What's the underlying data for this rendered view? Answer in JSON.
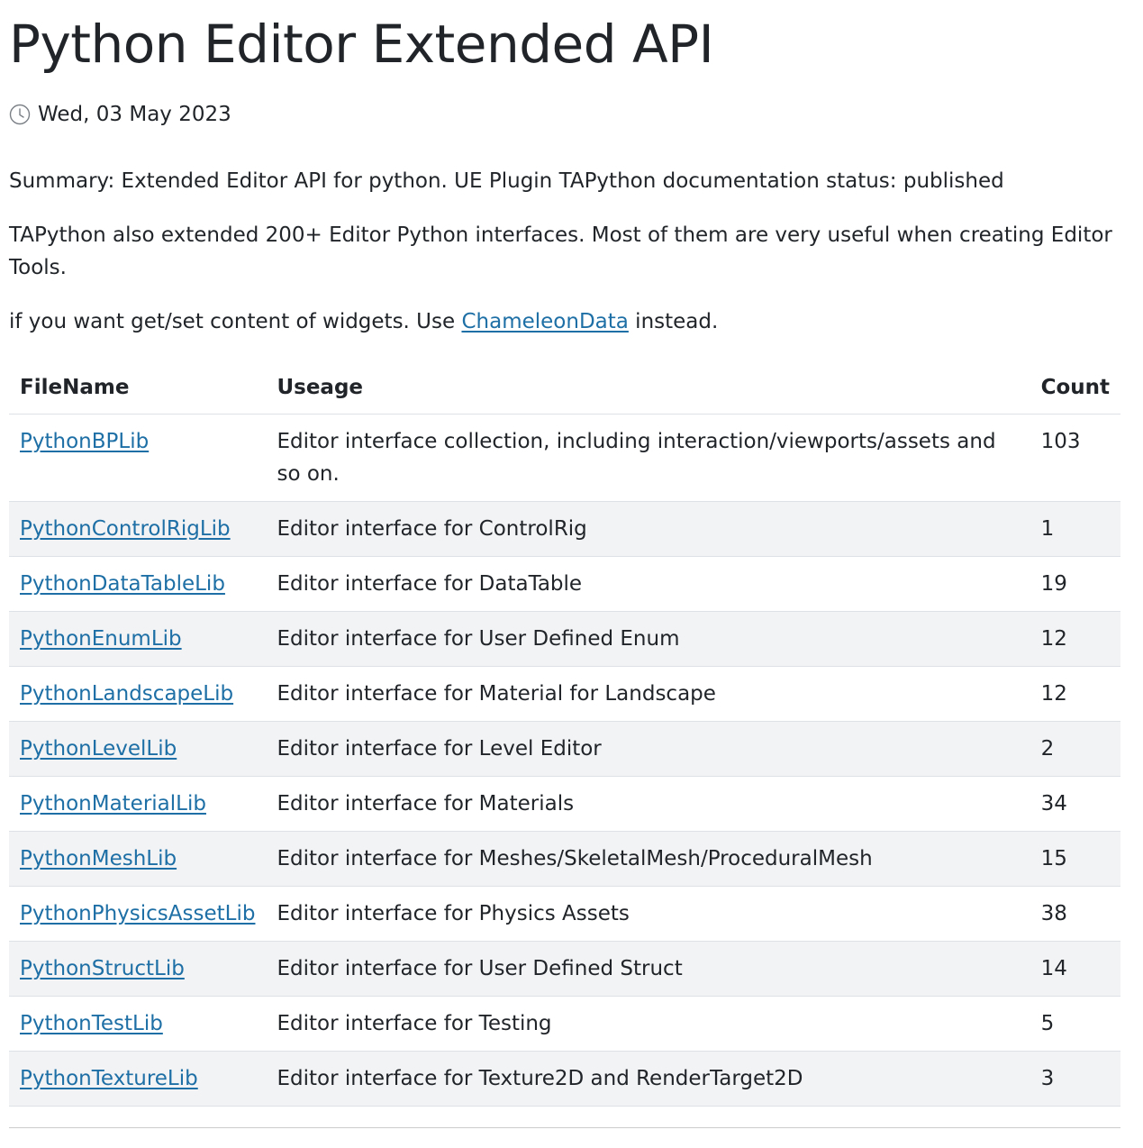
{
  "page": {
    "title": "Python Editor Extended API",
    "date": "Wed, 03 May 2023",
    "summary": "Summary: Extended Editor API for python. UE Plugin TAPython documentation status: published",
    "intro": "TAPython also extended 200+ Editor Python interfaces. Most of them are very useful when creating Editor Tools.",
    "widgets_note_before": "if you want get/set content of widgets. Use ",
    "widgets_note_link": "ChameleonData",
    "widgets_note_after": " instead."
  },
  "table": {
    "headers": {
      "filename": "FileName",
      "usage": "Useage",
      "count": "Count"
    },
    "rows": [
      {
        "filename": "PythonBPLib",
        "usage": "Editor interface collection, including interaction/viewports/assets and so on.",
        "count": "103"
      },
      {
        "filename": "PythonControlRigLib",
        "usage": "Editor interface for ControlRig",
        "count": "1"
      },
      {
        "filename": "PythonDataTableLib",
        "usage": "Editor interface for DataTable",
        "count": "19"
      },
      {
        "filename": "PythonEnumLib",
        "usage": "Editor interface for User Defined Enum",
        "count": "12"
      },
      {
        "filename": "PythonLandscapeLib",
        "usage": "Editor interface for Material for Landscape",
        "count": "12"
      },
      {
        "filename": "PythonLevelLib",
        "usage": "Editor interface for Level Editor",
        "count": "2"
      },
      {
        "filename": "PythonMaterialLib",
        "usage": "Editor interface for Materials",
        "count": "34"
      },
      {
        "filename": "PythonMeshLib",
        "usage": "Editor interface for Meshes/SkeletalMesh/ProceduralMesh",
        "count": "15"
      },
      {
        "filename": "PythonPhysicsAssetLib",
        "usage": "Editor interface for Physics Assets",
        "count": "38"
      },
      {
        "filename": "PythonStructLib",
        "usage": "Editor interface for User Defined Struct",
        "count": "14"
      },
      {
        "filename": "PythonTestLib",
        "usage": "Editor interface for Testing",
        "count": "5"
      },
      {
        "filename": "PythonTextureLib",
        "usage": "Editor interface for Texture2D and RenderTarget2D",
        "count": "3"
      }
    ]
  },
  "colors": {
    "link": "#1d6fa5",
    "text": "#212529",
    "stripe": "#f2f3f5",
    "border": "#dee2e6"
  },
  "icons": {
    "date": "clock-icon"
  }
}
